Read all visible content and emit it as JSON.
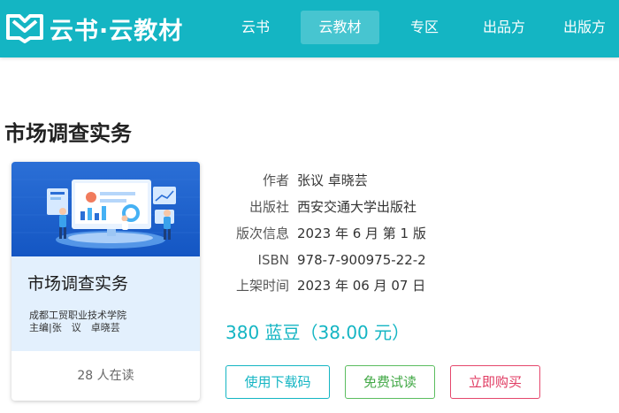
{
  "header": {
    "logo_text": "云书·云教材",
    "nav": [
      {
        "label": "云书"
      },
      {
        "label": "云教材"
      },
      {
        "label": "专区"
      },
      {
        "label": "出品方"
      },
      {
        "label": "出版方"
      }
    ],
    "active_index": 1,
    "colors": {
      "bar": "#14b5c3"
    }
  },
  "book": {
    "title": "市场调查实务",
    "cover": {
      "title": "市场调查实务",
      "school": "成都工贸职业技术学院",
      "editor": "主编|张　议　卓晓芸"
    },
    "readers": "28 人在读",
    "meta": [
      {
        "label": "作者",
        "value": "张议 卓晓芸"
      },
      {
        "label": "出版社",
        "value": "西安交通大学出版社"
      },
      {
        "label": "版次信息",
        "value": "2023 年 6 月 第 1 版"
      },
      {
        "label": "ISBN",
        "value": "978-7-900975-22-2"
      },
      {
        "label": "上架时间",
        "value": "2023 年 06 月 07 日"
      }
    ],
    "price": "380 蓝豆（38.00 元）"
  },
  "actions": {
    "download": "使用下载码",
    "trial": "免费试读",
    "buy": "立即购买"
  }
}
